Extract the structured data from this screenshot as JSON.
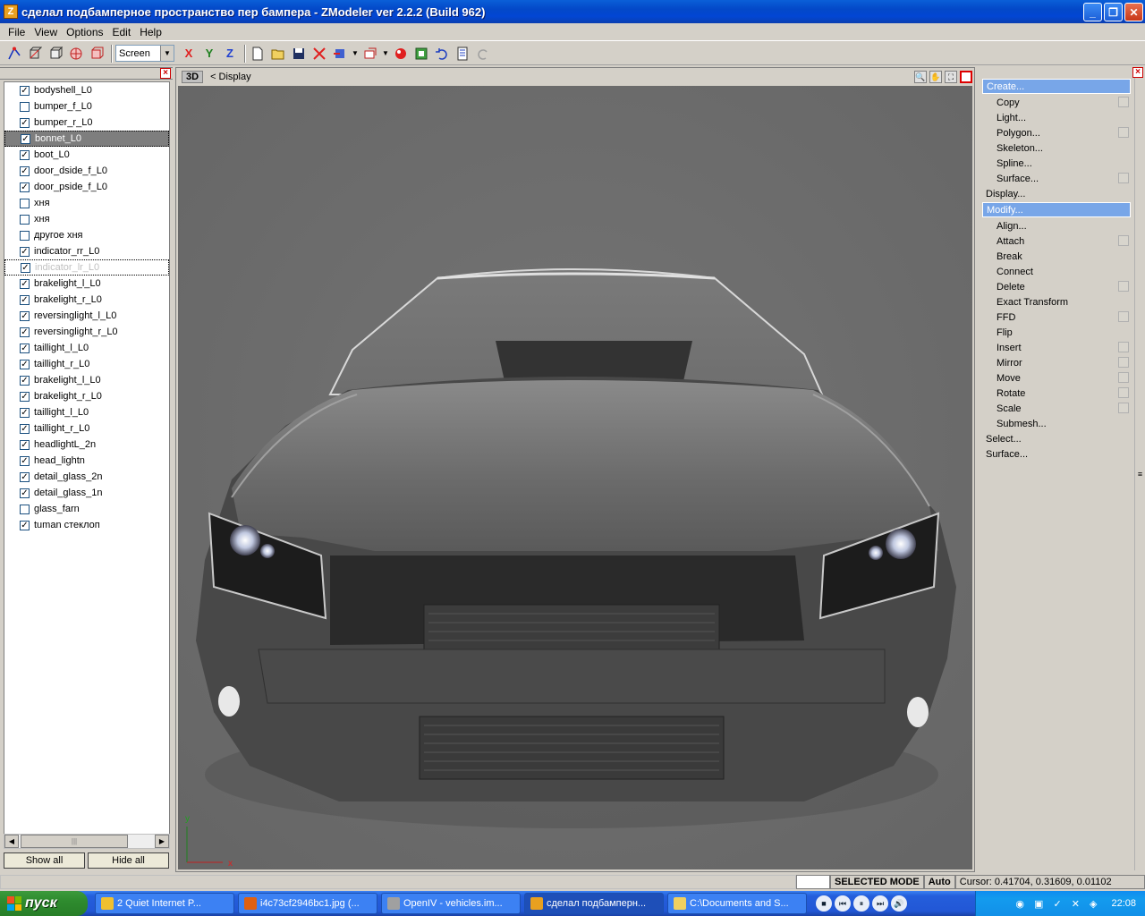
{
  "window": {
    "title": "сделал подбамперное пространство пер бампера - ZModeler ver 2.2.2 (Build 962)",
    "app_icon": "Z",
    "minimize": "_",
    "maximize": "❐",
    "close": "✕"
  },
  "menubar": [
    "File",
    "View",
    "Options",
    "Edit",
    "Help"
  ],
  "toolbar": {
    "view_mode": "Screen",
    "axis_x": "X",
    "axis_y": "Y",
    "axis_z": "Z"
  },
  "objects": [
    {
      "label": "bodyshell_L0",
      "checked": true
    },
    {
      "label": "bumper_f_L0",
      "checked": false
    },
    {
      "label": "bumper_r_L0",
      "checked": true
    },
    {
      "label": "bonnet_L0",
      "checked": true,
      "selected": true
    },
    {
      "label": "boot_L0",
      "checked": true
    },
    {
      "label": "door_dside_f_L0",
      "checked": true
    },
    {
      "label": "door_pside_f_L0",
      "checked": true
    },
    {
      "label": "хня",
      "checked": false
    },
    {
      "label": "хня",
      "checked": false
    },
    {
      "label": "другое хня",
      "checked": false
    },
    {
      "label": "indicator_rr_L0",
      "checked": true
    },
    {
      "label": "indicator_lr_L0",
      "checked": true,
      "faded": true
    },
    {
      "label": "brakelight_l_L0",
      "checked": true
    },
    {
      "label": "brakelight_r_L0",
      "checked": true
    },
    {
      "label": "reversinglight_l_L0",
      "checked": true
    },
    {
      "label": "reversinglight_r_L0",
      "checked": true
    },
    {
      "label": "taillight_l_L0",
      "checked": true
    },
    {
      "label": "taillight_r_L0",
      "checked": true
    },
    {
      "label": "brakelight_l_L0",
      "checked": true
    },
    {
      "label": "brakelight_r_L0",
      "checked": true
    },
    {
      "label": "taillight_l_L0",
      "checked": true
    },
    {
      "label": "taillight_r_L0",
      "checked": true
    },
    {
      "label": "headlightL_2n",
      "checked": true
    },
    {
      "label": "head_lightn",
      "checked": true
    },
    {
      "label": "detail_glass_2n",
      "checked": true
    },
    {
      "label": "detail_glass_1n",
      "checked": true
    },
    {
      "label": "glass_farn",
      "checked": false
    },
    {
      "label": "tuman стеклоп",
      "checked": true
    }
  ],
  "left_buttons": {
    "show_all": "Show all",
    "hide_all": "Hide all"
  },
  "viewport": {
    "mode_badge": "3D",
    "title": "< Display",
    "axis_y": "y",
    "axis_x": "x"
  },
  "commands": [
    {
      "label": "Create...",
      "level": 0,
      "highlight": true
    },
    {
      "label": "Copy",
      "level": 1,
      "opt": true
    },
    {
      "label": "Light...",
      "level": 1,
      "opt": false
    },
    {
      "label": "Polygon...",
      "level": 1,
      "opt": true
    },
    {
      "label": "Skeleton...",
      "level": 1,
      "opt": false
    },
    {
      "label": "Spline...",
      "level": 1,
      "opt": false
    },
    {
      "label": "Surface...",
      "level": 1,
      "opt": true
    },
    {
      "label": "Display...",
      "level": 0,
      "highlight": false
    },
    {
      "label": "Modify...",
      "level": 0,
      "highlight": true
    },
    {
      "label": "Align...",
      "level": 1,
      "opt": false
    },
    {
      "label": "Attach",
      "level": 1,
      "opt": true
    },
    {
      "label": "Break",
      "level": 1,
      "opt": false
    },
    {
      "label": "Connect",
      "level": 1,
      "opt": false
    },
    {
      "label": "Delete",
      "level": 1,
      "opt": true
    },
    {
      "label": "Exact Transform",
      "level": 1,
      "opt": false
    },
    {
      "label": "FFD",
      "level": 1,
      "opt": true
    },
    {
      "label": "Flip",
      "level": 1,
      "opt": false
    },
    {
      "label": "Insert",
      "level": 1,
      "opt": true
    },
    {
      "label": "Mirror",
      "level": 1,
      "opt": true
    },
    {
      "label": "Move",
      "level": 1,
      "opt": true
    },
    {
      "label": "Rotate",
      "level": 1,
      "opt": true
    },
    {
      "label": "Scale",
      "level": 1,
      "opt": true
    },
    {
      "label": "Submesh...",
      "level": 1,
      "opt": false
    },
    {
      "label": "Select...",
      "level": 0,
      "highlight": false
    },
    {
      "label": "Surface...",
      "level": 0,
      "highlight": false
    }
  ],
  "status": {
    "mode": "SELECTED MODE",
    "auto": "Auto",
    "cursor": "Cursor: 0.41704, 0.31609, 0.01102"
  },
  "taskbar": {
    "start": "пуск",
    "tasks": [
      {
        "label": "2 Quiet Internet P...",
        "icon_color": "#f0c030",
        "active": false
      },
      {
        "label": "i4c73cf2946bc1.jpg (...",
        "icon_color": "#e06010",
        "active": false
      },
      {
        "label": "OpenIV - vehicles.im...",
        "icon_color": "#a0a0a0",
        "active": false
      },
      {
        "label": "сделал подбамперн...",
        "icon_color": "#e8a020",
        "active": true
      },
      {
        "label": "C:\\Documents and S...",
        "icon_color": "#f0d060",
        "active": false
      }
    ],
    "clock": "22:08"
  }
}
